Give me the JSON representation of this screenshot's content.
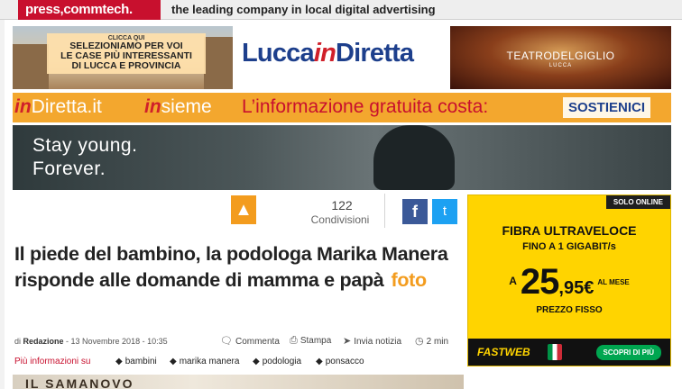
{
  "pressbar": {
    "logo": "press,commtech.",
    "tagline": "the leading company in local digital advertising"
  },
  "ad_case": {
    "clicca": "CLICCA QUI",
    "lines": [
      "SELEZIONIAMO PER VOI",
      "LE CASE PIÙ INTERESSANTI",
      "DI LUCCA E PROVINCIA"
    ]
  },
  "lucca": {
    "pre": "Lucca",
    "in": "in",
    "post": "Diretta"
  },
  "teatro": {
    "name": "TEATRODELGIGLIO",
    "city": "LUCCA"
  },
  "strip": {
    "in1": "in",
    "diretta": "Diretta.it",
    "in2": "in",
    "sieme": "sieme",
    "message": "L’informazione gratuita costa:",
    "cta": "SOSTIENICI"
  },
  "stay_ad": {
    "line1": "Stay young.",
    "line2": "Forever."
  },
  "share": {
    "count": "122",
    "label": "Condivisioni",
    "fb": "f",
    "tw": "t"
  },
  "article": {
    "title": "Il piede del bambino, la podologa Marika Manera risponde alle domande di mamma e papà",
    "foto": "foto",
    "byline_prefix": "di ",
    "author": "Redazione",
    "date": " - 13 Novembre 2018 - 10:35",
    "actions": {
      "comment": "Commenta",
      "print": "Stampa",
      "send": "Invia notizia",
      "read_time": "2 min"
    },
    "more_label": "Più informazioni su",
    "tags": [
      "bambini",
      "marika manera",
      "podologia",
      "ponsacco"
    ],
    "image_text": "IL SAMANOVO"
  },
  "fastweb": {
    "badge": "SOLO ONLINE",
    "headline": "FIBRA ULTRAVELOCE",
    "sub": "FINO A 1 GIGABIT/s",
    "a": "A",
    "price_int": "25",
    "price_dec": ",95€",
    "per": "AL MESE",
    "fisso": "PREZZO FISSO",
    "brand": "FASTWEB",
    "cta": "SCOPRI DI PIÙ"
  },
  "colors": {
    "press_red": "#c8102e",
    "orange": "#f3a72e",
    "lucca_blue": "#1d3f8c",
    "fastweb_yellow": "#ffd400",
    "foto_orange": "#f39c1e"
  }
}
